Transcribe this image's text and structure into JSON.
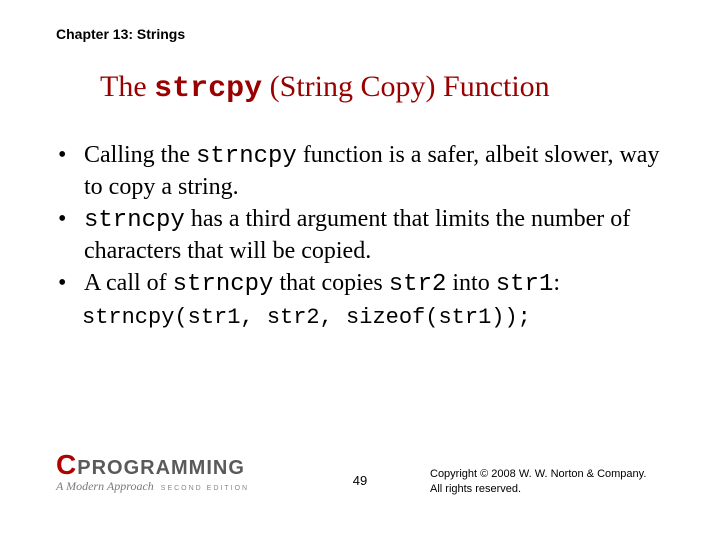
{
  "chapter": "Chapter 13: Strings",
  "title": {
    "pre": "The ",
    "code": "strcpy",
    "post": " (String Copy) Function"
  },
  "bullets": [
    {
      "parts": [
        {
          "t": "Calling the "
        },
        {
          "t": "strncpy",
          "mono": true
        },
        {
          "t": " function is a safer, albeit slower, way to copy a string."
        }
      ]
    },
    {
      "parts": [
        {
          "t": "strncpy",
          "mono": true
        },
        {
          "t": " has a third argument that limits the number of characters that will be copied."
        }
      ]
    },
    {
      "parts": [
        {
          "t": "A call of "
        },
        {
          "t": "strncpy",
          "mono": true
        },
        {
          "t": " that copies "
        },
        {
          "t": "str2",
          "mono": true
        },
        {
          "t": " into "
        },
        {
          "t": "str1",
          "mono": true
        },
        {
          "t": ":"
        }
      ]
    }
  ],
  "codeblock": "strncpy(str1, str2, sizeof(str1));",
  "logo": {
    "c": "C",
    "prog": "PROGRAMMING",
    "sub": "A Modern Approach",
    "edition": "SECOND EDITION"
  },
  "page": "49",
  "copyright": {
    "line1": "Copyright © 2008 W. W. Norton & Company.",
    "line2": "All rights reserved."
  }
}
